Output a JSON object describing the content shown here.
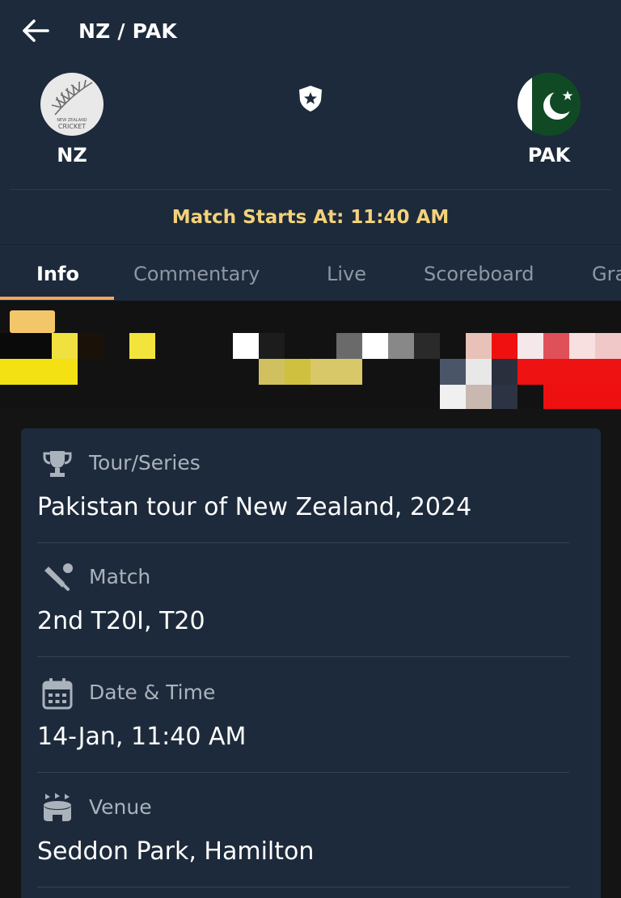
{
  "header": {
    "title": "NZ / PAK"
  },
  "teams": {
    "home": {
      "name": "NZ",
      "logo_text": "NEW ZEALAND CRICKET"
    },
    "away": {
      "name": "PAK"
    }
  },
  "match_start": "Match Starts At: 11:40 AM",
  "tabs": [
    {
      "label": "Info",
      "active": true
    },
    {
      "label": "Commentary",
      "active": false
    },
    {
      "label": "Live",
      "active": false
    },
    {
      "label": "Scoreboard",
      "active": false
    },
    {
      "label": "Gra",
      "active": false
    }
  ],
  "info": [
    {
      "label": "Tour/Series",
      "value": "Pakistan tour of New Zealand, 2024",
      "icon": "trophy-icon"
    },
    {
      "label": "Match",
      "value": "2nd T20I, T20",
      "icon": "cricket-bat-icon"
    },
    {
      "label": "Date & Time",
      "value": "14-Jan, 11:40 AM",
      "icon": "calendar-icon"
    },
    {
      "label": "Venue",
      "value": "Seddon Park, Hamilton",
      "icon": "stadium-icon"
    }
  ],
  "colors": {
    "header_bg": "#1d2a3b",
    "accent": "#f2a65a",
    "match_start_text": "#f3d27a",
    "page_bg": "#141414"
  }
}
